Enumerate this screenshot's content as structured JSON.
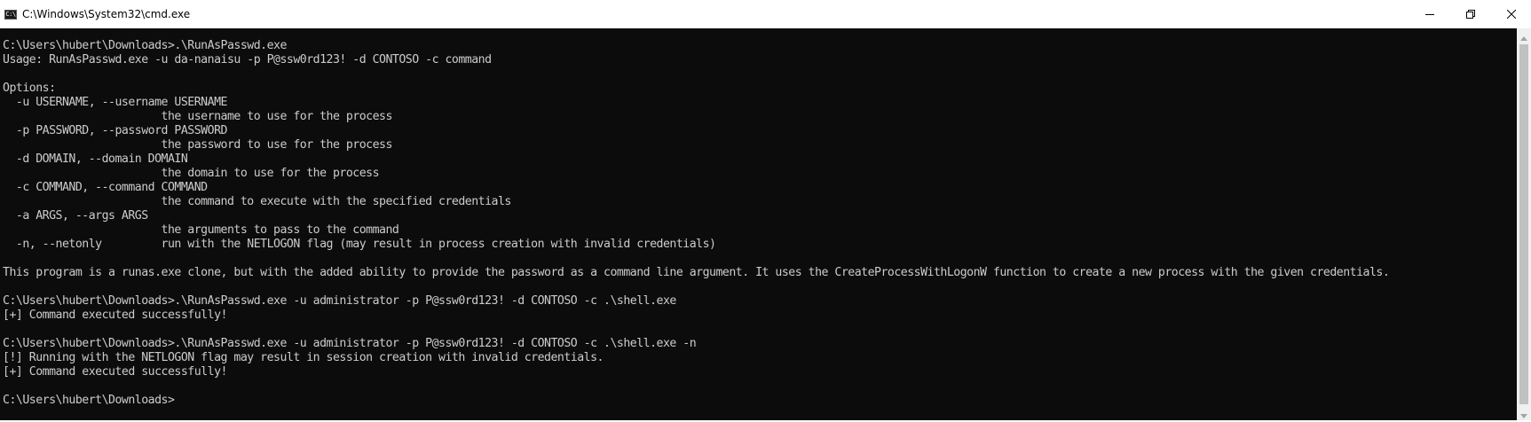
{
  "window": {
    "title": "C:\\Windows\\System32\\cmd.exe",
    "icon": "cmd-icon",
    "icon_text": "C:\\"
  },
  "controls": {
    "minimize_icon": "minimize-icon",
    "maximize_icon": "restore-icon",
    "close_icon": "close-icon"
  },
  "colors": {
    "console_background": "#0c0c0c",
    "console_text": "#cccccc",
    "titlebar_background": "#ffffff",
    "scrollbar_track": "#f0f0f0",
    "scrollbar_thumb": "#c1c1c1"
  },
  "console": {
    "lines": [
      "C:\\Users\\hubert\\Downloads>.\\RunAsPasswd.exe",
      "Usage: RunAsPasswd.exe -u da-nanaisu -p P@ssw0rd123! -d CONTOSO -c command",
      "",
      "Options:",
      "  -u USERNAME, --username USERNAME",
      "                        the username to use for the process",
      "  -p PASSWORD, --password PASSWORD",
      "                        the password to use for the process",
      "  -d DOMAIN, --domain DOMAIN",
      "                        the domain to use for the process",
      "  -c COMMAND, --command COMMAND",
      "                        the command to execute with the specified credentials",
      "  -a ARGS, --args ARGS",
      "                        the arguments to pass to the command",
      "  -n, --netonly         run with the NETLOGON flag (may result in process creation with invalid credentials)",
      "",
      "This program is a runas.exe clone, but with the added ability to provide the password as a command line argument. It uses the CreateProcessWithLogonW function to create a new process with the given credentials.",
      "",
      "C:\\Users\\hubert\\Downloads>.\\RunAsPasswd.exe -u administrator -p P@ssw0rd123! -d CONTOSO -c .\\shell.exe",
      "[+] Command executed successfully!",
      "",
      "C:\\Users\\hubert\\Downloads>.\\RunAsPasswd.exe -u administrator -p P@ssw0rd123! -d CONTOSO -c .\\shell.exe -n",
      "[!] Running with the NETLOGON flag may result in session creation with invalid credentials.",
      "[+] Command executed successfully!",
      "",
      "C:\\Users\\hubert\\Downloads>"
    ]
  }
}
